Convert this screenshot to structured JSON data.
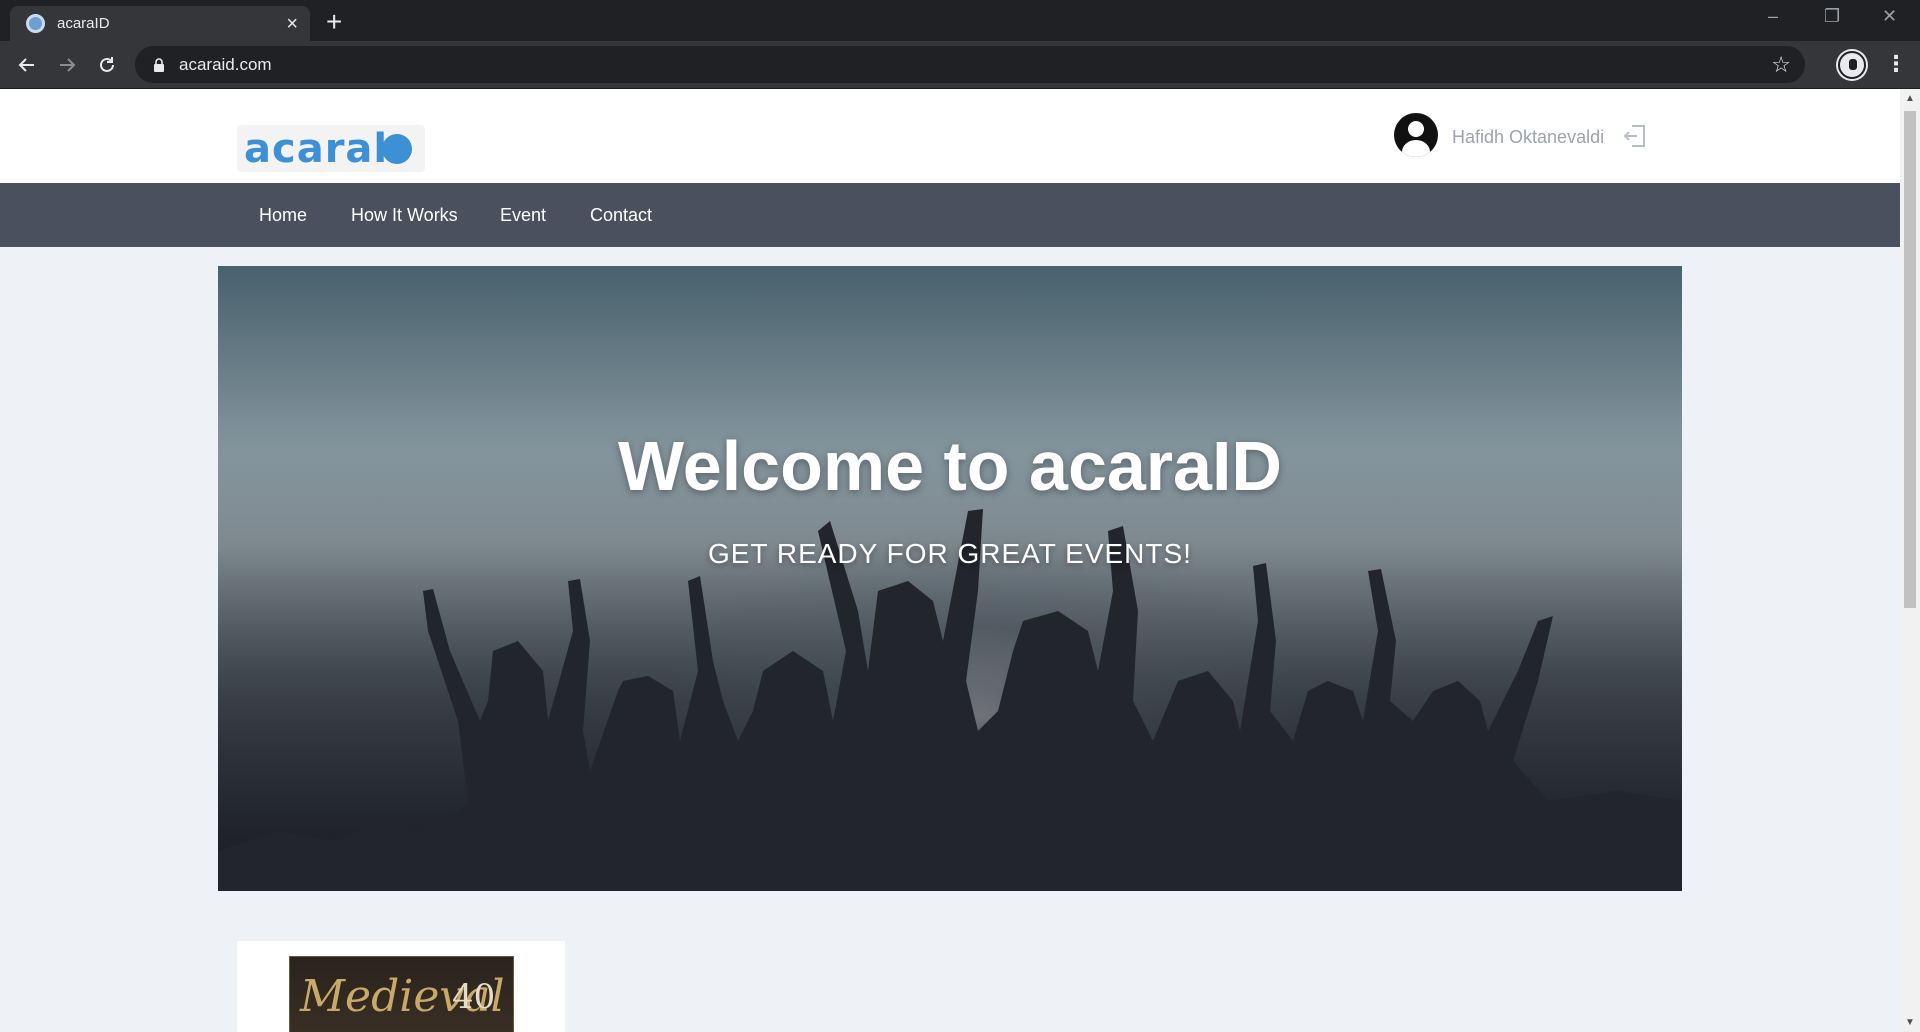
{
  "browser": {
    "tab_title": "acaraID",
    "tab_close": "×",
    "new_tab": "+",
    "url": "acaraid.com",
    "window_controls": [
      "–",
      "❐",
      "✕"
    ]
  },
  "site": {
    "logo_text": "acaral",
    "user_name": "Hafidh Oktanevaldi",
    "nav": [
      "Home",
      "How It Works",
      "Event",
      "Contact"
    ],
    "hero_title": "Welcome to acaraID",
    "hero_subtitle": "GET READY FOR GREAT EVENTS!",
    "event_poster_title": "Medieval",
    "event_poster_number": "40"
  },
  "colors": {
    "navbar": "#4a505d",
    "logo": "#3d8fd6",
    "page_bg": "#eef1f5"
  }
}
